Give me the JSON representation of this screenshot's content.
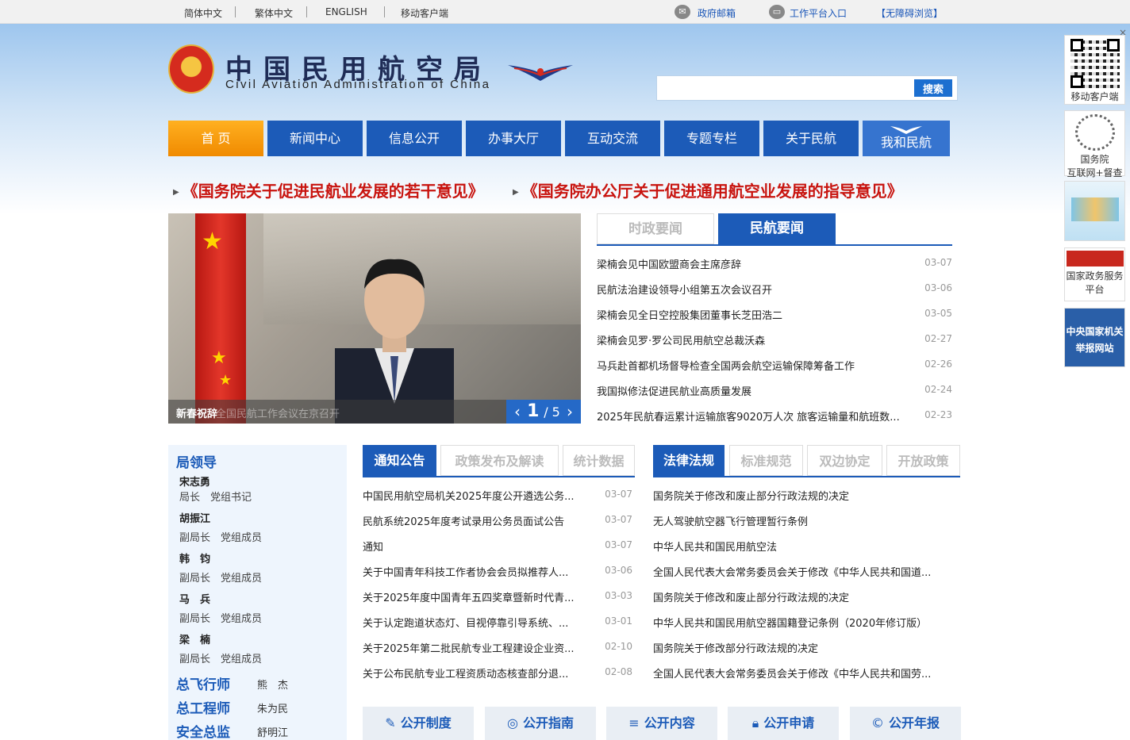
{
  "topbar": {
    "links": [
      "简体中文",
      "繁体中文",
      "ENGLISH",
      "移动客户端"
    ],
    "mail": "政府邮箱",
    "workbench": "工作平台入口",
    "accessible": "【无障碍浏览】"
  },
  "header": {
    "title_cn": "中国民用航空局",
    "title_en": "Civil Aviation Administration of China",
    "search_placeholder": "",
    "search_button": "搜索"
  },
  "nav": [
    "首 页",
    "新闻中心",
    "信息公开",
    "办事大厅",
    "互动交流",
    "专题专栏",
    "关于民航",
    "我和民航"
  ],
  "headlines": [
    "《国务院关于促进民航业发展的若干意见》",
    "《国务院办公厅关于促进通用航空业发展的指导意见》"
  ],
  "carousel": {
    "caption": "新春祝辞",
    "caption_overlay": "全国民航工作会议在京召开",
    "pager_current": "1",
    "pager_total": "/ 5"
  },
  "news": {
    "tabs": [
      "时政要闻",
      "民航要闻"
    ],
    "items": [
      {
        "title": "梁楠会见中国欧盟商会主席彦辞",
        "date": "03-07"
      },
      {
        "title": "民航法治建设领导小组第五次会议召开",
        "date": "03-06"
      },
      {
        "title": "梁楠会见全日空控股集团董事长芝田浩二",
        "date": "03-05"
      },
      {
        "title": "梁楠会见罗·罗公司民用航空总裁沃森",
        "date": "02-27"
      },
      {
        "title": "马兵赴首都机场督导检查全国两会航空运输保障筹备工作",
        "date": "02-26"
      },
      {
        "title": "我国拟修法促进民航业高质量发展",
        "date": "02-24"
      },
      {
        "title": "2025年民航春运累计运输旅客9020万人次 旅客运输量和航班数...",
        "date": "02-23"
      }
    ]
  },
  "leaders": {
    "title": "局领导",
    "people": [
      {
        "name": "宋志勇",
        "role": "局长　党组书记"
      },
      {
        "name": "胡振江",
        "role": "副局长　党组成员"
      },
      {
        "name": "韩　钧",
        "role": "副局长　党组成员"
      },
      {
        "name": "马　兵",
        "role": "副局长　党组成员"
      },
      {
        "name": "梁　楠",
        "role": "副局长　党组成员"
      }
    ],
    "others": [
      {
        "title": "总飞行师",
        "name": "熊　杰"
      },
      {
        "title": "总工程师",
        "name": "朱为民"
      },
      {
        "title": "安全总监",
        "name": "舒明江"
      }
    ]
  },
  "notices": {
    "tabs": [
      "通知公告",
      "政策发布及解读",
      "统计数据"
    ],
    "items": [
      {
        "title": "中国民用航空局机关2025年度公开遴选公务...",
        "date": "03-07"
      },
      {
        "title": "民航系统2025年度考试录用公务员面试公告",
        "date": "03-07"
      },
      {
        "title": "通知",
        "date": "03-07"
      },
      {
        "title": "关于中国青年科技工作者协会会员拟推荐人...",
        "date": "03-06"
      },
      {
        "title": "关于2025年度中国青年五四奖章暨新时代青...",
        "date": "03-03"
      },
      {
        "title": "关于认定跑道状态灯、目视停靠引导系统、...",
        "date": "03-01"
      },
      {
        "title": "关于2025年第二批民航专业工程建设企业资...",
        "date": "02-10"
      },
      {
        "title": "关于公布民航专业工程资质动态核查部分退...",
        "date": "02-08"
      }
    ]
  },
  "laws": {
    "tabs": [
      "法律法规",
      "标准规范",
      "双边协定",
      "开放政策"
    ],
    "items": [
      {
        "title": "国务院关于修改和废止部分行政法规的决定"
      },
      {
        "title": "无人驾驶航空器飞行管理暂行条例"
      },
      {
        "title": "中华人民共和国民用航空法"
      },
      {
        "title": "全国人民代表大会常务委员会关于修改《中华人民共和国道..."
      },
      {
        "title": "国务院关于修改和废止部分行政法规的决定"
      },
      {
        "title": "中华人民共和国民用航空器国籍登记条例（2020年修订版）"
      },
      {
        "title": "国务院关于修改部分行政法规的决定"
      },
      {
        "title": "全国人民代表大会常务委员会关于修改《中华人民共和国劳..."
      }
    ]
  },
  "open_buttons": [
    {
      "label": "公开制度",
      "icon": "pen-icon"
    },
    {
      "label": "公开指南",
      "icon": "compass-icon"
    },
    {
      "label": "公开内容",
      "icon": "list-icon"
    },
    {
      "label": "公开申请",
      "icon": "lock-icon"
    },
    {
      "label": "公开年报",
      "icon": "copyright-icon"
    }
  ],
  "sidebar": {
    "close": "×",
    "mobile": "移动客户端",
    "gov_line1": "国务院",
    "gov_line2": "互联网+督查",
    "service_line1": "国家政务服务",
    "service_line2": "平台",
    "report_line1": "中央国家机关",
    "report_line2": "举报网站"
  },
  "colors": {
    "nav_blue": "#1c5bb8",
    "nav_active_orange": "#f08a00",
    "headline_red": "#c8140f"
  }
}
